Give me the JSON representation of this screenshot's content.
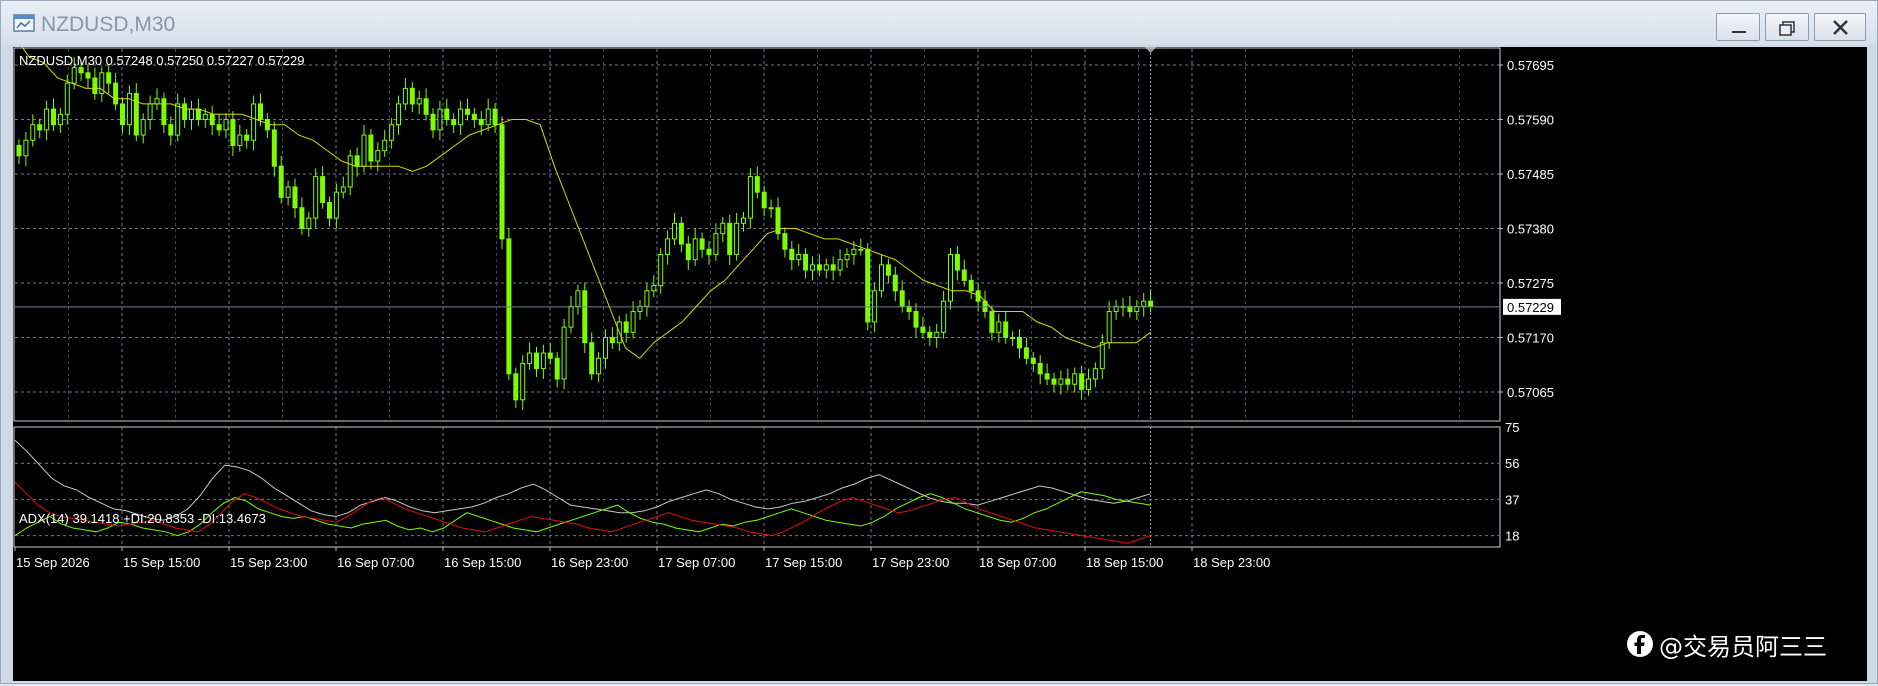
{
  "window": {
    "title": "NZDUSD,M30",
    "controls": [
      "minimize",
      "maximize",
      "close"
    ]
  },
  "chart_info": {
    "main_label": "NZDUSD,M30  0.57248 0.57250 0.57227 0.57229",
    "current_price": "0.57229",
    "price_axis": [
      "0.57695",
      "0.57590",
      "0.57485",
      "0.57380",
      "0.57275",
      "0.57170",
      "0.57065"
    ],
    "indicator_label": "ADX(14) 39.1418 +DI:20.8353 -DI:13.4673",
    "indicator_axis": [
      "75",
      "56",
      "37",
      "18"
    ],
    "time_axis": [
      "15 Sep 2026",
      "15 Sep 15:00",
      "15 Sep 23:00",
      "16 Sep 07:00",
      "16 Sep 15:00",
      "16 Sep 23:00",
      "17 Sep 07:00",
      "17 Sep 15:00",
      "17 Sep 23:00",
      "18 Sep 07:00",
      "18 Sep 15:00",
      "18 Sep 23:00"
    ]
  },
  "colors": {
    "background": "#000000",
    "grid": "#6e7a86",
    "candle": "#7CFC00",
    "moving_average": "#d8d800",
    "adx": "#c8c8c8",
    "plus_di": "#7cfc00",
    "minus_di": "#e01010"
  },
  "watermark": {
    "icon": "facebook-icon",
    "text": "@交易员阿三三"
  },
  "chart_data": [
    {
      "type": "candlestick",
      "title": "NZDUSD,M30",
      "ylim": [
        0.5702,
        0.5775
      ],
      "close": [
        0.5752,
        0.5755,
        0.5758,
        0.5757,
        0.5761,
        0.5758,
        0.576,
        0.5766,
        0.5769,
        0.5768,
        0.5767,
        0.5764,
        0.5768,
        0.5766,
        0.5762,
        0.5758,
        0.5764,
        0.5756,
        0.5759,
        0.5762,
        0.5763,
        0.5758,
        0.5756,
        0.5762,
        0.5759,
        0.5761,
        0.5759,
        0.576,
        0.5758,
        0.5757,
        0.5759,
        0.5754,
        0.5756,
        0.5755,
        0.5762,
        0.5759,
        0.5757,
        0.575,
        0.5744,
        0.5746,
        0.5742,
        0.5738,
        0.574,
        0.5748,
        0.5743,
        0.574,
        0.5745,
        0.5746,
        0.5752,
        0.575,
        0.5756,
        0.5751,
        0.5753,
        0.5755,
        0.5758,
        0.5762,
        0.5765,
        0.5762,
        0.5763,
        0.576,
        0.5757,
        0.5761,
        0.5759,
        0.5758,
        0.5761,
        0.576,
        0.5759,
        0.5758,
        0.5761,
        0.5758,
        0.5736,
        0.571,
        0.5705,
        0.5712,
        0.5714,
        0.5711,
        0.5714,
        0.5713,
        0.5709,
        0.5719,
        0.5723,
        0.5726,
        0.5716,
        0.571,
        0.5713,
        0.5717,
        0.5716,
        0.572,
        0.5718,
        0.5722,
        0.5723,
        0.5726,
        0.5727,
        0.5733,
        0.5736,
        0.5739,
        0.5735,
        0.5732,
        0.5736,
        0.5734,
        0.5733,
        0.5737,
        0.5739,
        0.5733,
        0.5739,
        0.574,
        0.5748,
        0.5745,
        0.5742,
        0.5742,
        0.5737,
        0.5734,
        0.5732,
        0.5733,
        0.573,
        0.5731,
        0.573,
        0.5731,
        0.573,
        0.5732,
        0.5733,
        0.5734,
        0.5734,
        0.572,
        0.5726,
        0.5731,
        0.5729,
        0.5726,
        0.5723,
        0.5722,
        0.5719,
        0.5718,
        0.5717,
        0.5718,
        0.5724,
        0.5733,
        0.573,
        0.5728,
        0.5726,
        0.5724,
        0.5722,
        0.5718,
        0.572,
        0.5717,
        0.5717,
        0.5715,
        0.5713,
        0.5712,
        0.571,
        0.5709,
        0.5708,
        0.5709,
        0.5708,
        0.571,
        0.5707,
        0.5709,
        0.5711,
        0.5716,
        0.5722,
        0.5723,
        0.5723,
        0.5722,
        0.5723,
        0.5724,
        0.5723
      ],
      "moving_average": [
        0.5775,
        0.5771,
        0.577,
        0.5767,
        0.5766,
        0.5765,
        0.5765,
        0.5763,
        0.5763,
        0.5762,
        0.5762,
        0.5762,
        0.5761,
        0.5761,
        0.576,
        0.576,
        0.576,
        0.5759,
        0.5758,
        0.5758,
        0.5756,
        0.5755,
        0.5753,
        0.5751,
        0.575,
        0.575,
        0.575,
        0.575,
        0.5749,
        0.575,
        0.5752,
        0.5754,
        0.5756,
        0.5757,
        0.5758,
        0.5759,
        0.5759,
        0.5758,
        0.575,
        0.5743,
        0.5736,
        0.5729,
        0.5722,
        0.5715,
        0.5713,
        0.5716,
        0.5718,
        0.572,
        0.5723,
        0.5726,
        0.5728,
        0.5731,
        0.5734,
        0.5737,
        0.5738,
        0.5738,
        0.5737,
        0.5736,
        0.5736,
        0.5735,
        0.5734,
        0.5733,
        0.5732,
        0.573,
        0.5728,
        0.5727,
        0.5726,
        0.5726,
        0.5725,
        0.5722,
        0.5722,
        0.5722,
        0.572,
        0.5719,
        0.5717,
        0.5716,
        0.5715,
        0.5716,
        0.5716,
        0.5716,
        0.5718
      ],
      "current_price": 0.57229
    },
    {
      "type": "line",
      "title": "ADX(14) 39.1418 +DI:20.8353 -DI:13.4673",
      "ylim": [
        12,
        75
      ],
      "series": [
        {
          "name": "ADX",
          "values": [
            68,
            62,
            55,
            48,
            44,
            42,
            38,
            35,
            32,
            31,
            29,
            27,
            26,
            28,
            32,
            39,
            48,
            55,
            54,
            52,
            48,
            43,
            39,
            35,
            31,
            29,
            28,
            30,
            34,
            36,
            38,
            36,
            33,
            31,
            30,
            31,
            32,
            33,
            35,
            38,
            40,
            43,
            45,
            42,
            38,
            34,
            33,
            32,
            31,
            30,
            30,
            31,
            33,
            36,
            38,
            40,
            42,
            40,
            37,
            35,
            33,
            32,
            33,
            35,
            36,
            38,
            40,
            43,
            45,
            48,
            50,
            47,
            44,
            41,
            38,
            36,
            35,
            35,
            34,
            36,
            38,
            40,
            42,
            44,
            43,
            41,
            39,
            37,
            36,
            35,
            36,
            38,
            40
          ]
        },
        {
          "name": "+DI",
          "values": [
            18,
            22,
            25,
            28,
            24,
            22,
            21,
            20,
            22,
            25,
            24,
            22,
            21,
            20,
            18,
            20,
            24,
            30,
            35,
            38,
            36,
            32,
            30,
            28,
            27,
            28,
            26,
            24,
            23,
            22,
            24,
            25,
            26,
            23,
            21,
            22,
            20,
            22,
            26,
            30,
            28,
            26,
            24,
            22,
            21,
            20,
            22,
            24,
            26,
            28,
            30,
            32,
            34,
            30,
            27,
            25,
            24,
            22,
            21,
            20,
            22,
            24,
            23,
            25,
            26,
            28,
            30,
            32,
            30,
            28,
            26,
            25,
            24,
            23,
            25,
            28,
            32,
            35,
            38,
            40,
            38,
            35,
            32,
            30,
            28,
            26,
            25,
            27,
            30,
            32,
            35,
            38,
            41,
            40,
            39,
            37,
            36,
            35,
            34
          ]
        },
        {
          "name": "-DI",
          "values": [
            46,
            40,
            34,
            30,
            28,
            27,
            26,
            25,
            24,
            23,
            24,
            25,
            26,
            24,
            22,
            21,
            20,
            24,
            30,
            36,
            40,
            38,
            35,
            32,
            30,
            28,
            27,
            26,
            25,
            28,
            32,
            36,
            38,
            35,
            32,
            30,
            28,
            26,
            24,
            22,
            21,
            20,
            22,
            24,
            26,
            28,
            27,
            26,
            25,
            24,
            22,
            21,
            20,
            22,
            24,
            26,
            28,
            30,
            28,
            26,
            25,
            24,
            23,
            22,
            20,
            19,
            18,
            20,
            23,
            26,
            30,
            33,
            36,
            38,
            36,
            34,
            32,
            30,
            31,
            33,
            35,
            37,
            38,
            35,
            32,
            30,
            28,
            26,
            24,
            22,
            21,
            20,
            19,
            18,
            17,
            16,
            15,
            14,
            16,
            18
          ]
        }
      ]
    }
  ]
}
